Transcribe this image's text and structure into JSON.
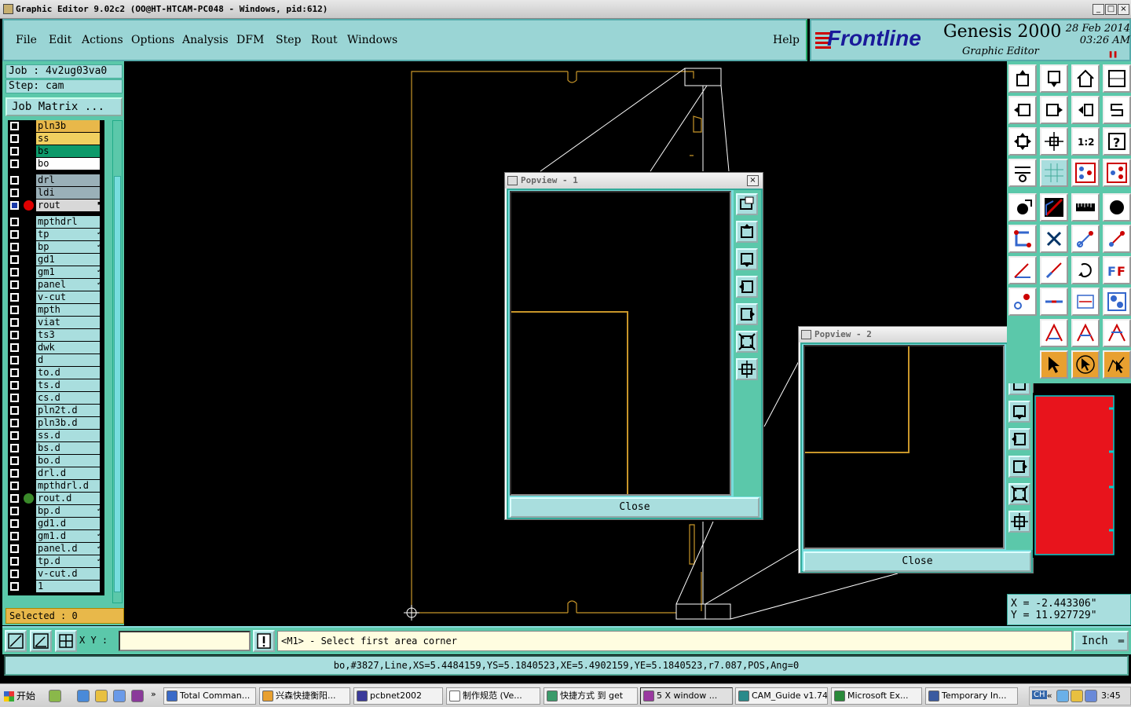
{
  "window": {
    "title": "Graphic Editor 9.02c2  (OO@HT-HTCAM-PC048 - Windows, pid:612)"
  },
  "menu": {
    "items": [
      "File",
      "Edit",
      "Actions",
      "Options",
      "Analysis",
      "DFM",
      "Step",
      "Rout",
      "Windows"
    ],
    "help": "Help"
  },
  "brand": {
    "logo": "Frontline",
    "product": "Genesis 2000",
    "subtitle": "Graphic Editor",
    "date": "28 Feb 2014",
    "time": "03:26 AM",
    "pause_icon": "pause-icon"
  },
  "left": {
    "job": "Job : 4v2ug03va0",
    "step": "Step: cam",
    "job_matrix": "Job Matrix ...",
    "selected": "Selected : 0",
    "layers": [
      {
        "name": "pln3b",
        "color": "#e8b84a",
        "dot": "",
        "mark": ""
      },
      {
        "name": "ss",
        "color": "#f0d060",
        "dot": "",
        "mark": ""
      },
      {
        "name": "bs",
        "color": "#0d9a6a",
        "dot": "",
        "mark": ""
      },
      {
        "name": "bo",
        "color": "#ffffff",
        "dot": "",
        "mark": ""
      },
      {
        "name": "drl",
        "color": "#9ab0b8",
        "dot": "",
        "mark": "",
        "gap": true
      },
      {
        "name": "ldi",
        "color": "#9ab0b8",
        "dot": "",
        "mark": ""
      },
      {
        "name": "rout",
        "color": "#d8d8d8",
        "dot": "#e00000",
        "mark": "▪",
        "checked": true
      },
      {
        "name": "mpthdrl",
        "color": "#a9dede",
        "dot": "",
        "mark": "",
        "gap": true
      },
      {
        "name": "tp",
        "color": "#a9dede",
        "dot": "",
        "mark": "↙"
      },
      {
        "name": "bp",
        "color": "#a9dede",
        "dot": "",
        "mark": "↙"
      },
      {
        "name": "gd1",
        "color": "#a9dede",
        "dot": "",
        "mark": ""
      },
      {
        "name": "gm1",
        "color": "#a9dede",
        "dot": "",
        "mark": "↙"
      },
      {
        "name": "panel",
        "color": "#a9dede",
        "dot": "",
        "mark": "↙"
      },
      {
        "name": "v-cut",
        "color": "#a9dede",
        "dot": "",
        "mark": ""
      },
      {
        "name": "mpth",
        "color": "#a9dede",
        "dot": "",
        "mark": ""
      },
      {
        "name": "viat",
        "color": "#a9dede",
        "dot": "",
        "mark": ""
      },
      {
        "name": "ts3",
        "color": "#a9dede",
        "dot": "",
        "mark": ""
      },
      {
        "name": "dwk",
        "color": "#a9dede",
        "dot": "",
        "mark": ""
      },
      {
        "name": "d",
        "color": "#a9dede",
        "dot": "",
        "mark": ""
      },
      {
        "name": "to.d",
        "color": "#a9dede",
        "dot": "",
        "mark": ""
      },
      {
        "name": "ts.d",
        "color": "#a9dede",
        "dot": "",
        "mark": ""
      },
      {
        "name": "cs.d",
        "color": "#a9dede",
        "dot": "",
        "mark": ""
      },
      {
        "name": "pln2t.d",
        "color": "#a9dede",
        "dot": "",
        "mark": ""
      },
      {
        "name": "pln3b.d",
        "color": "#a9dede",
        "dot": "",
        "mark": ""
      },
      {
        "name": "ss.d",
        "color": "#a9dede",
        "dot": "",
        "mark": ""
      },
      {
        "name": "bs.d",
        "color": "#a9dede",
        "dot": "",
        "mark": ""
      },
      {
        "name": "bo.d",
        "color": "#a9dede",
        "dot": "",
        "mark": ""
      },
      {
        "name": "drl.d",
        "color": "#a9dede",
        "dot": "",
        "mark": ""
      },
      {
        "name": "mpthdrl.d",
        "color": "#a9dede",
        "dot": "",
        "mark": ""
      },
      {
        "name": "rout.d",
        "color": "#a9dede",
        "dot": "#3a8a2a",
        "mark": ""
      },
      {
        "name": "bp.d",
        "color": "#a9dede",
        "dot": "",
        "mark": "↙"
      },
      {
        "name": "gd1.d",
        "color": "#a9dede",
        "dot": "",
        "mark": ""
      },
      {
        "name": "gm1.d",
        "color": "#a9dede",
        "dot": "",
        "mark": "↙"
      },
      {
        "name": "panel.d",
        "color": "#a9dede",
        "dot": "",
        "mark": "↙"
      },
      {
        "name": "tp.d",
        "color": "#a9dede",
        "dot": "",
        "mark": "↙"
      },
      {
        "name": "v-cut.d",
        "color": "#a9dede",
        "dot": "",
        "mark": ""
      },
      {
        "name": "1",
        "color": "#a9dede",
        "dot": "",
        "mark": ""
      }
    ]
  },
  "popview1": {
    "title": "Popview - 1",
    "close": "Close"
  },
  "popview2": {
    "title": "Popview - 2",
    "close": "Close"
  },
  "coords": {
    "x": "X = -2.443306\"",
    "y": "Y = 11.927729\""
  },
  "command": {
    "xy_label": "X Y :",
    "xy_value": "",
    "prompt": "<M1> - Select first area corner",
    "units": "Inch"
  },
  "status": "bo,#3827,Line,XS=5.4484159,YS=5.1840523,XE=5.4902159,YE=5.1840523,r7.087,POS,Ang=0",
  "taskbar": {
    "start": "开始",
    "items": [
      {
        "label": "Total Comman...",
        "color": "#3a6ac8"
      },
      {
        "label": "兴森快捷衡阳...",
        "color": "#e8a030"
      },
      {
        "label": "pcbnet2002",
        "color": "#3a3a9a"
      },
      {
        "label": "制作规范 (Ve...",
        "color": "#ffffff"
      },
      {
        "label": "快捷方式 到 get",
        "color": "#3a9a6a"
      },
      {
        "label": "5 X window ...",
        "color": "#9a3aa0"
      },
      {
        "label": "CAM_Guide v1.74",
        "color": "#2a8a8a"
      },
      {
        "label": "Microsoft Ex...",
        "color": "#2a8a3a"
      },
      {
        "label": "Temporary In...",
        "color": "#3a5aa0"
      }
    ],
    "clock": "3:45",
    "lang": "CH"
  }
}
